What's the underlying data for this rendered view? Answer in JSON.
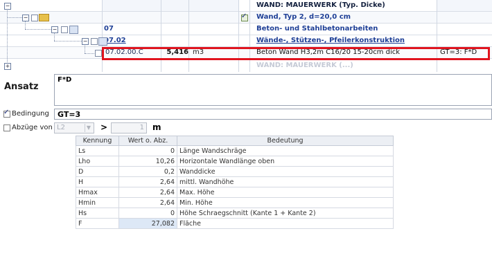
{
  "tree": {
    "rows": [
      {
        "code": "",
        "qty": "",
        "unit": "",
        "text": "WAND: MAUERWERK (Typ. Dicke)",
        "formula": ""
      },
      {
        "code": "",
        "qty": "",
        "unit": "",
        "text": "Wand, Typ 2, d=20,0 cm",
        "formula": ""
      },
      {
        "code": "07",
        "qty": "",
        "unit": "",
        "text": "Beton- und Stahlbetonarbeiten",
        "formula": ""
      },
      {
        "code": "07.02",
        "qty": "",
        "unit": "",
        "text": "Wände-, Stützen-, Pfeilerkonstruktion",
        "formula": ""
      },
      {
        "code": "07.02.00.C",
        "qty": "5,416",
        "unit": "m3",
        "text": "Beton Wand H3,2m C16/20 15-20cm dick",
        "formula": "GT=3: F*D"
      },
      {
        "code": "",
        "qty": "",
        "unit": "",
        "text": "WAND: MAUERWERK (...)",
        "formula": ""
      }
    ]
  },
  "ansatz": {
    "label": "Ansatz",
    "formula": "F*D"
  },
  "bedingung": {
    "label": "Bedingung",
    "checked": true,
    "value": "GT=3"
  },
  "abzuege": {
    "label": "Abzüge von",
    "checked": false,
    "select_value": "L2",
    "operator": ">",
    "value": "1",
    "unit": "m"
  },
  "params": {
    "headers": [
      "Kennung",
      "Wert o. Abz.",
      "Bedeutung"
    ],
    "rows": [
      [
        "Ls",
        "0",
        "Länge Wandschräge"
      ],
      [
        "Lho",
        "10,26",
        "Horizontale Wandlänge oben"
      ],
      [
        "D",
        "0,2",
        "Wanddicke"
      ],
      [
        "H",
        "2,64",
        "mittl. Wandhöhe"
      ],
      [
        "Hmax",
        "2,64",
        "Max. Höhe"
      ],
      [
        "Hmin",
        "2,64",
        "Min. Höhe"
      ],
      [
        "Hs",
        "0",
        "Höhe Schraegschnitt (Kante 1 + Kante 2)"
      ],
      [
        "F",
        "27,082",
        "Fläche"
      ]
    ]
  },
  "colors": {
    "highlight": "#e0141e",
    "tree_text_blue": "#1e3f96"
  }
}
